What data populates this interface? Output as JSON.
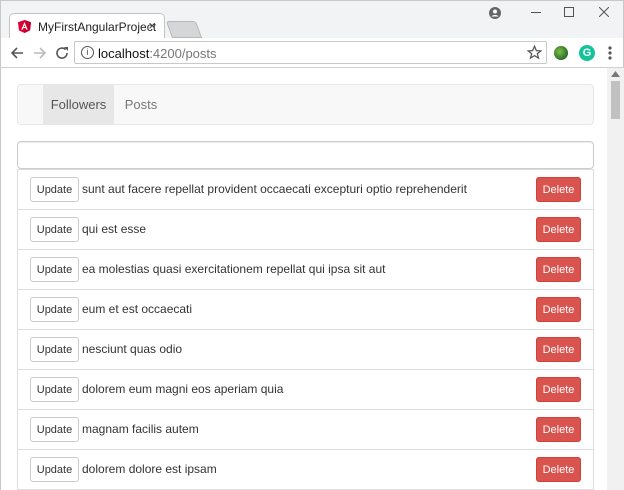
{
  "browser": {
    "tab_title": "MyFirstAngularProject",
    "tab_close": "×",
    "url_host": "localhost",
    "url_path": ":4200/posts",
    "info_icon": "i",
    "ext2_label": "G",
    "icons": {
      "back": "arrow-left-icon",
      "forward": "arrow-right-icon",
      "reload": "reload-icon",
      "star": "star-icon",
      "menu": "kebab-menu-icon"
    }
  },
  "colors": {
    "primary_danger": "#d9534f",
    "angular_red": "#dd0031",
    "navbar_bg": "#f8f8f8"
  },
  "nav": {
    "items": [
      {
        "label": "Followers",
        "active": true
      },
      {
        "label": "Posts",
        "active": false
      }
    ]
  },
  "search": {
    "value": "",
    "placeholder": ""
  },
  "posts": {
    "update_label": "Update",
    "delete_label": "Delete",
    "items": [
      {
        "title": "sunt aut facere repellat provident occaecati excepturi optio reprehenderit"
      },
      {
        "title": "qui est esse"
      },
      {
        "title": "ea molestias quasi exercitationem repellat qui ipsa sit aut"
      },
      {
        "title": "eum et est occaecati"
      },
      {
        "title": "nesciunt quas odio"
      },
      {
        "title": "dolorem eum magni eos aperiam quia"
      },
      {
        "title": "magnam facilis autem"
      },
      {
        "title": "dolorem dolore est ipsam"
      }
    ]
  }
}
